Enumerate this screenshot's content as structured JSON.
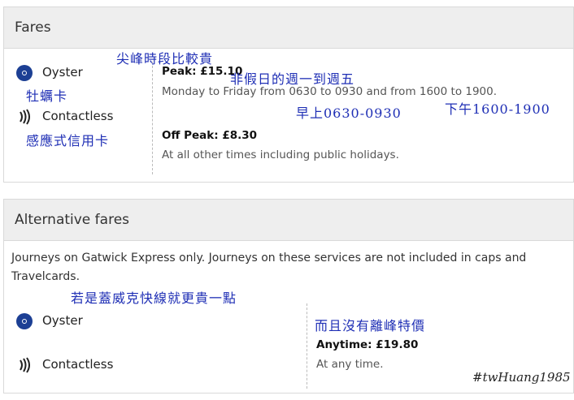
{
  "fares": {
    "title": "Fares",
    "payment": [
      {
        "label": "Oyster",
        "icon": "oyster-icon"
      },
      {
        "label": "Contactless",
        "icon": "contactless-icon"
      }
    ],
    "peak": {
      "title": "Peak: £15.10",
      "desc": "Monday to Friday from 0630 to 0930 and from 1600 to 1900."
    },
    "offpeak": {
      "title": "Off Peak: £8.30",
      "desc": "At all other times including public holidays."
    }
  },
  "alt": {
    "title": "Alternative fares",
    "intro_line1": "Journeys on Gatwick Express only. Journeys on these services are not included in caps and",
    "intro_line2": "Travelcards.",
    "payment": [
      {
        "label": "Oyster",
        "icon": "oyster-icon"
      },
      {
        "label": "Contactless",
        "icon": "contactless-icon"
      }
    ],
    "anytime": {
      "title": "Anytime: £19.80",
      "desc": "At any time."
    }
  },
  "annotations": {
    "peak_expensive": "尖峰時段比較貴",
    "oyster_card": "牡蠣卡",
    "weekday": "非假日的週一到週五",
    "contactless_card": "感應式信用卡",
    "morning": "早上0630-0930",
    "afternoon": "下午1600-1900",
    "gatwick": "若是蓋威克快線就更貴一點",
    "no_offpeak": "而且沒有離峰特價",
    "hashtag": "#twHuang1985"
  },
  "colors": {
    "oyster_blue": "#1c3f94",
    "annotation_blue": "#1f2fb5",
    "header_bg": "#eeeeee"
  }
}
